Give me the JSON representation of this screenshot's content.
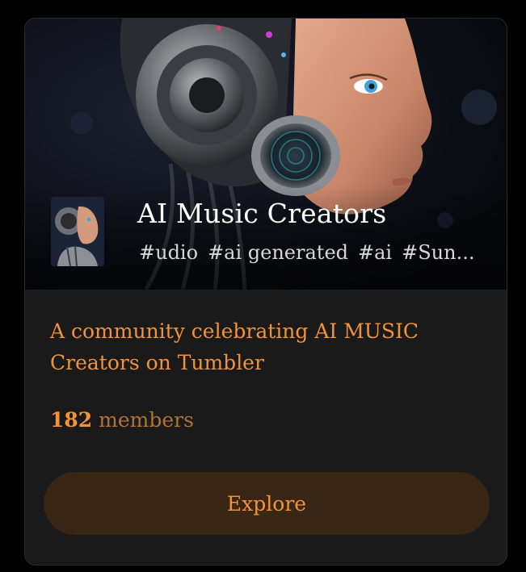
{
  "community": {
    "title": "AI Music Creators",
    "tags": [
      "#udio",
      "#ai generated",
      "#ai",
      "#Sun..."
    ],
    "description": "A community celebrating AI MUSIC Creators on Tumbler",
    "member_count": "182",
    "member_label": "members",
    "explore_label": "Explore"
  },
  "images": {
    "banner": "robot-woman-with-headphones-banner",
    "avatar": "robot-woman-avatar"
  },
  "colors": {
    "card_background": "#1a1a1a",
    "accent": "#f2933a",
    "accent_muted": "#b07339",
    "button_background": "#3a2614",
    "page_background": "#000000"
  }
}
